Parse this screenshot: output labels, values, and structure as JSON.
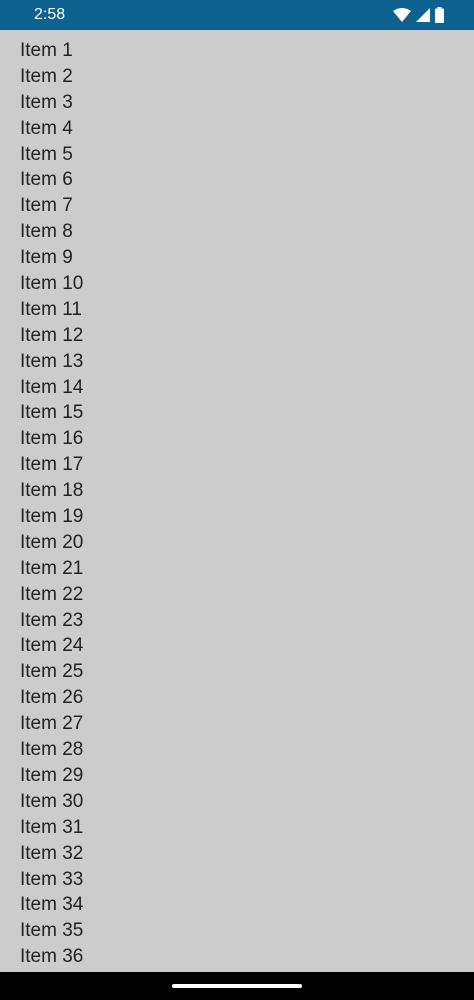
{
  "status_bar": {
    "time": "2:58",
    "icons": [
      "wifi-icon",
      "cell-signal-icon",
      "battery-icon"
    ],
    "background": "#0d6290"
  },
  "list": {
    "background": "#cccccc",
    "items": [
      "Item 1",
      "Item 2",
      "Item 3",
      "Item 4",
      "Item 5",
      "Item 6",
      "Item 7",
      "Item 8",
      "Item 9",
      "Item 10",
      "Item 11",
      "Item 12",
      "Item 13",
      "Item 14",
      "Item 15",
      "Item 16",
      "Item 17",
      "Item 18",
      "Item 19",
      "Item 20",
      "Item 21",
      "Item 22",
      "Item 23",
      "Item 24",
      "Item 25",
      "Item 26",
      "Item 27",
      "Item 28",
      "Item 29",
      "Item 30",
      "Item 31",
      "Item 32",
      "Item 33",
      "Item 34",
      "Item 35",
      "Item 36"
    ]
  },
  "nav_bar": {
    "handle_icon": "home-handle-icon"
  }
}
